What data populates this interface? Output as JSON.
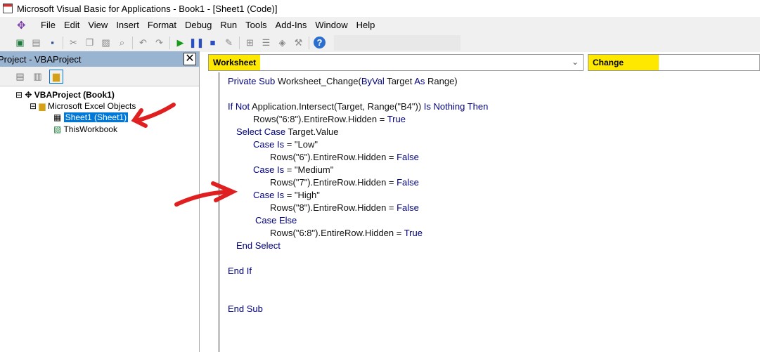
{
  "window": {
    "title": "Microsoft Visual Basic for Applications - Book1 - [Sheet1 (Code)]"
  },
  "menu": [
    "File",
    "Edit",
    "View",
    "Insert",
    "Format",
    "Debug",
    "Run",
    "Tools",
    "Add-Ins",
    "Window",
    "Help"
  ],
  "toolbar_icons": [
    "excel-icon",
    "insert-userform-icon",
    "save-icon",
    "cut-icon",
    "copy-icon",
    "paste-icon",
    "find-icon",
    "undo-icon",
    "redo-icon",
    "run-icon",
    "break-icon",
    "reset-icon",
    "design-mode-icon",
    "project-explorer-icon",
    "properties-icon",
    "object-browser-icon",
    "toolbox-icon",
    "help-icon"
  ],
  "project": {
    "title": "Project - VBAProject",
    "close": "✕",
    "root": "VBAProject (Book1)",
    "folder": "Microsoft Excel Objects",
    "items": [
      "Sheet1 (Sheet1)",
      "ThisWorkbook"
    ],
    "selected": "Sheet1 (Sheet1)"
  },
  "code": {
    "object": "Worksheet",
    "procedure": "Change",
    "lines": [
      {
        "indent": 0,
        "segs": [
          [
            "Private Sub",
            1
          ],
          [
            " Worksheet_Change(",
            0
          ],
          [
            "ByVal",
            1
          ],
          [
            " Target ",
            0
          ],
          [
            "As",
            1
          ],
          [
            " Range)",
            0
          ]
        ]
      },
      {
        "indent": 0,
        "segs": [
          [
            "If Not",
            1
          ],
          [
            " Application.Intersect(Target, Range(\"B4\")) ",
            0
          ],
          [
            "Is Nothing Then",
            1
          ]
        ]
      },
      {
        "indent": 36,
        "segs": [
          [
            "Rows(\"6:8\").EntireRow.Hidden = ",
            0
          ],
          [
            "True",
            1
          ]
        ]
      },
      {
        "indent": 12,
        "segs": [
          [
            "Select Case",
            1
          ],
          [
            " Target.Value",
            0
          ]
        ]
      },
      {
        "indent": 36,
        "segs": [
          [
            "Case Is",
            1
          ],
          [
            " = \"Low\"",
            0
          ]
        ]
      },
      {
        "indent": 60,
        "segs": [
          [
            "Rows(\"6\").EntireRow.Hidden = ",
            0
          ],
          [
            "False",
            1
          ]
        ]
      },
      {
        "indent": 36,
        "segs": [
          [
            "Case Is",
            1
          ],
          [
            " = \"Medium\"",
            0
          ]
        ]
      },
      {
        "indent": 60,
        "segs": [
          [
            "Rows(\"7\").EntireRow.Hidden = ",
            0
          ],
          [
            "False",
            1
          ]
        ]
      },
      {
        "indent": 36,
        "segs": [
          [
            "Case Is",
            1
          ],
          [
            " = \"High\"",
            0
          ]
        ]
      },
      {
        "indent": 60,
        "segs": [
          [
            "Rows(\"8\").EntireRow.Hidden = ",
            0
          ],
          [
            "False",
            1
          ]
        ]
      },
      {
        "indent": 39,
        "segs": [
          [
            "Case Else",
            1
          ]
        ]
      },
      {
        "indent": 60,
        "segs": [
          [
            "Rows(\"6:8\").EntireRow.Hidden = ",
            0
          ],
          [
            "True",
            1
          ]
        ]
      },
      {
        "indent": 12,
        "segs": [
          [
            "End Select",
            1
          ]
        ]
      },
      {
        "indent": 0,
        "segs": [
          [
            "End If",
            1
          ]
        ]
      },
      {
        "indent": 0,
        "segs": [
          [
            "End Sub",
            1
          ]
        ]
      }
    ]
  },
  "colors": {
    "keyword": "#00007f",
    "highlight": "#ffe800",
    "selection": "#0078d7",
    "annotation": "#e02020"
  }
}
